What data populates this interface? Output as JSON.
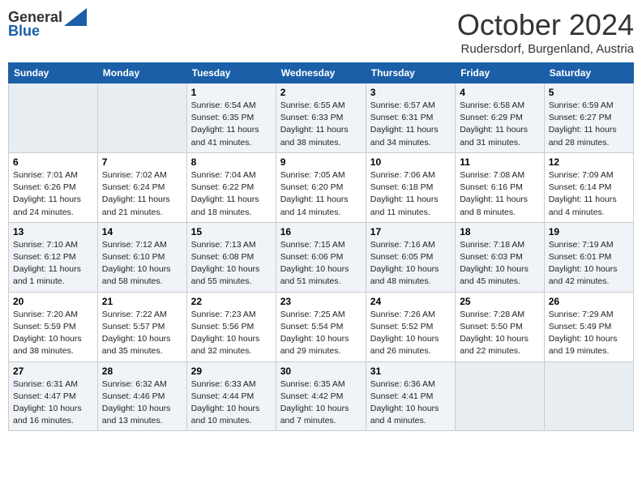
{
  "header": {
    "logo_general": "General",
    "logo_blue": "Blue",
    "month": "October 2024",
    "location": "Rudersdorf, Burgenland, Austria"
  },
  "weekdays": [
    "Sunday",
    "Monday",
    "Tuesday",
    "Wednesday",
    "Thursday",
    "Friday",
    "Saturday"
  ],
  "weeks": [
    [
      {
        "day": "",
        "info": ""
      },
      {
        "day": "",
        "info": ""
      },
      {
        "day": "1",
        "info": "Sunrise: 6:54 AM\nSunset: 6:35 PM\nDaylight: 11 hours and 41 minutes."
      },
      {
        "day": "2",
        "info": "Sunrise: 6:55 AM\nSunset: 6:33 PM\nDaylight: 11 hours and 38 minutes."
      },
      {
        "day": "3",
        "info": "Sunrise: 6:57 AM\nSunset: 6:31 PM\nDaylight: 11 hours and 34 minutes."
      },
      {
        "day": "4",
        "info": "Sunrise: 6:58 AM\nSunset: 6:29 PM\nDaylight: 11 hours and 31 minutes."
      },
      {
        "day": "5",
        "info": "Sunrise: 6:59 AM\nSunset: 6:27 PM\nDaylight: 11 hours and 28 minutes."
      }
    ],
    [
      {
        "day": "6",
        "info": "Sunrise: 7:01 AM\nSunset: 6:26 PM\nDaylight: 11 hours and 24 minutes."
      },
      {
        "day": "7",
        "info": "Sunrise: 7:02 AM\nSunset: 6:24 PM\nDaylight: 11 hours and 21 minutes."
      },
      {
        "day": "8",
        "info": "Sunrise: 7:04 AM\nSunset: 6:22 PM\nDaylight: 11 hours and 18 minutes."
      },
      {
        "day": "9",
        "info": "Sunrise: 7:05 AM\nSunset: 6:20 PM\nDaylight: 11 hours and 14 minutes."
      },
      {
        "day": "10",
        "info": "Sunrise: 7:06 AM\nSunset: 6:18 PM\nDaylight: 11 hours and 11 minutes."
      },
      {
        "day": "11",
        "info": "Sunrise: 7:08 AM\nSunset: 6:16 PM\nDaylight: 11 hours and 8 minutes."
      },
      {
        "day": "12",
        "info": "Sunrise: 7:09 AM\nSunset: 6:14 PM\nDaylight: 11 hours and 4 minutes."
      }
    ],
    [
      {
        "day": "13",
        "info": "Sunrise: 7:10 AM\nSunset: 6:12 PM\nDaylight: 11 hours and 1 minute."
      },
      {
        "day": "14",
        "info": "Sunrise: 7:12 AM\nSunset: 6:10 PM\nDaylight: 10 hours and 58 minutes."
      },
      {
        "day": "15",
        "info": "Sunrise: 7:13 AM\nSunset: 6:08 PM\nDaylight: 10 hours and 55 minutes."
      },
      {
        "day": "16",
        "info": "Sunrise: 7:15 AM\nSunset: 6:06 PM\nDaylight: 10 hours and 51 minutes."
      },
      {
        "day": "17",
        "info": "Sunrise: 7:16 AM\nSunset: 6:05 PM\nDaylight: 10 hours and 48 minutes."
      },
      {
        "day": "18",
        "info": "Sunrise: 7:18 AM\nSunset: 6:03 PM\nDaylight: 10 hours and 45 minutes."
      },
      {
        "day": "19",
        "info": "Sunrise: 7:19 AM\nSunset: 6:01 PM\nDaylight: 10 hours and 42 minutes."
      }
    ],
    [
      {
        "day": "20",
        "info": "Sunrise: 7:20 AM\nSunset: 5:59 PM\nDaylight: 10 hours and 38 minutes."
      },
      {
        "day": "21",
        "info": "Sunrise: 7:22 AM\nSunset: 5:57 PM\nDaylight: 10 hours and 35 minutes."
      },
      {
        "day": "22",
        "info": "Sunrise: 7:23 AM\nSunset: 5:56 PM\nDaylight: 10 hours and 32 minutes."
      },
      {
        "day": "23",
        "info": "Sunrise: 7:25 AM\nSunset: 5:54 PM\nDaylight: 10 hours and 29 minutes."
      },
      {
        "day": "24",
        "info": "Sunrise: 7:26 AM\nSunset: 5:52 PM\nDaylight: 10 hours and 26 minutes."
      },
      {
        "day": "25",
        "info": "Sunrise: 7:28 AM\nSunset: 5:50 PM\nDaylight: 10 hours and 22 minutes."
      },
      {
        "day": "26",
        "info": "Sunrise: 7:29 AM\nSunset: 5:49 PM\nDaylight: 10 hours and 19 minutes."
      }
    ],
    [
      {
        "day": "27",
        "info": "Sunrise: 6:31 AM\nSunset: 4:47 PM\nDaylight: 10 hours and 16 minutes."
      },
      {
        "day": "28",
        "info": "Sunrise: 6:32 AM\nSunset: 4:46 PM\nDaylight: 10 hours and 13 minutes."
      },
      {
        "day": "29",
        "info": "Sunrise: 6:33 AM\nSunset: 4:44 PM\nDaylight: 10 hours and 10 minutes."
      },
      {
        "day": "30",
        "info": "Sunrise: 6:35 AM\nSunset: 4:42 PM\nDaylight: 10 hours and 7 minutes."
      },
      {
        "day": "31",
        "info": "Sunrise: 6:36 AM\nSunset: 4:41 PM\nDaylight: 10 hours and 4 minutes."
      },
      {
        "day": "",
        "info": ""
      },
      {
        "day": "",
        "info": ""
      }
    ]
  ]
}
